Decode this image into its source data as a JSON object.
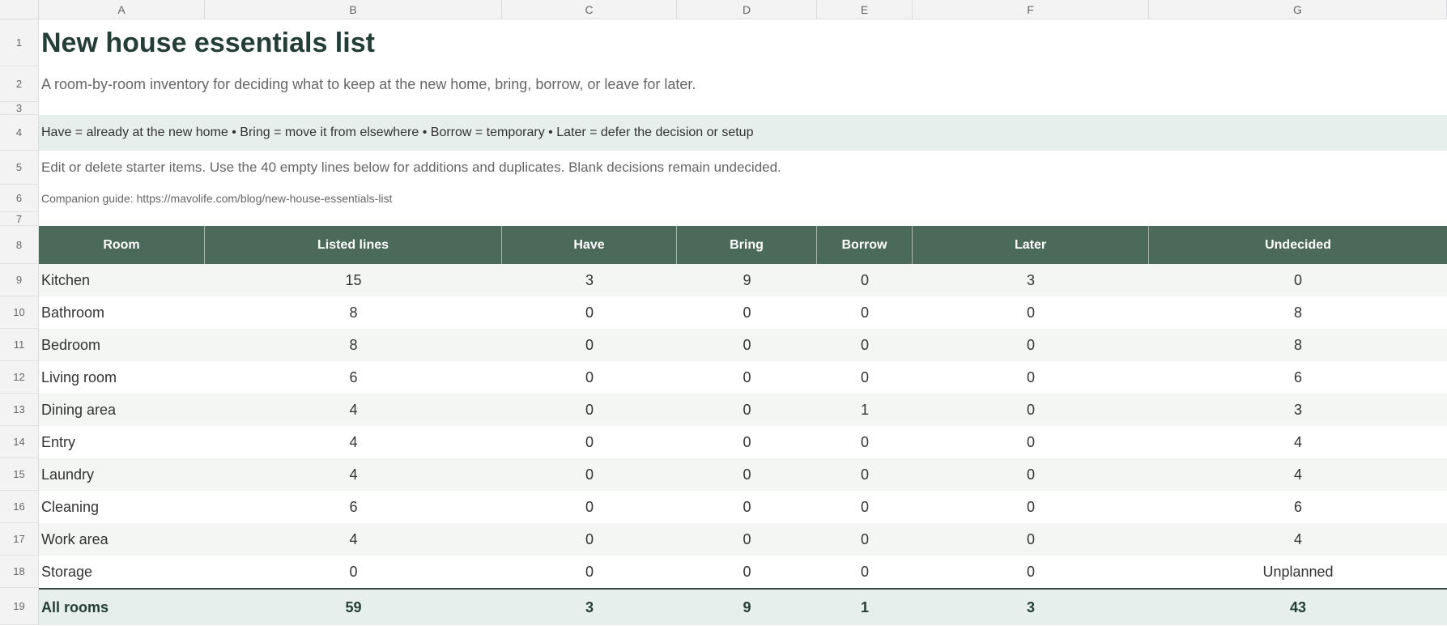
{
  "columns": [
    "A",
    "B",
    "C",
    "D",
    "E",
    "F",
    "G"
  ],
  "row_numbers": [
    "1",
    "2",
    "3",
    "4",
    "5",
    "6",
    "7",
    "8",
    "9",
    "10",
    "11",
    "12",
    "13",
    "14",
    "15",
    "16",
    "17",
    "18",
    "19"
  ],
  "title": "New house essentials list",
  "subtitle": "A room-by-room inventory for deciding what to keep at the new home, bring, borrow, or leave for later.",
  "legend": "Have = already at the new home  •  Bring = move it from elsewhere  •  Borrow = temporary  •  Later = defer the decision or setup",
  "note": "Edit or delete starter items. Use the 40 empty lines below for additions and duplicates. Blank decisions remain undecided.",
  "guide": "Companion guide: https://mavolife.com/blog/new-house-essentials-list",
  "table": {
    "headers": [
      "Room",
      "Listed lines",
      "Have",
      "Bring",
      "Borrow",
      "Later",
      "Undecided"
    ],
    "rows": [
      [
        "Kitchen",
        "15",
        "3",
        "9",
        "0",
        "3",
        "0"
      ],
      [
        "Bathroom",
        "8",
        "0",
        "0",
        "0",
        "0",
        "8"
      ],
      [
        "Bedroom",
        "8",
        "0",
        "0",
        "0",
        "0",
        "8"
      ],
      [
        "Living room",
        "6",
        "0",
        "0",
        "0",
        "0",
        "6"
      ],
      [
        "Dining area",
        "4",
        "0",
        "0",
        "1",
        "0",
        "3"
      ],
      [
        "Entry",
        "4",
        "0",
        "0",
        "0",
        "0",
        "4"
      ],
      [
        "Laundry",
        "4",
        "0",
        "0",
        "0",
        "0",
        "4"
      ],
      [
        "Cleaning",
        "6",
        "0",
        "0",
        "0",
        "0",
        "6"
      ],
      [
        "Work area",
        "4",
        "0",
        "0",
        "0",
        "0",
        "4"
      ],
      [
        "Storage",
        "0",
        "0",
        "0",
        "0",
        "0",
        "Unplanned"
      ]
    ],
    "total": [
      "All rooms",
      "59",
      "3",
      "9",
      "1",
      "3",
      "43"
    ]
  },
  "colors": {
    "header_fill": "#4b6a59",
    "legend_fill": "#e6efeb",
    "band_fill": "#f4f6f3",
    "title_text": "#243d36"
  }
}
